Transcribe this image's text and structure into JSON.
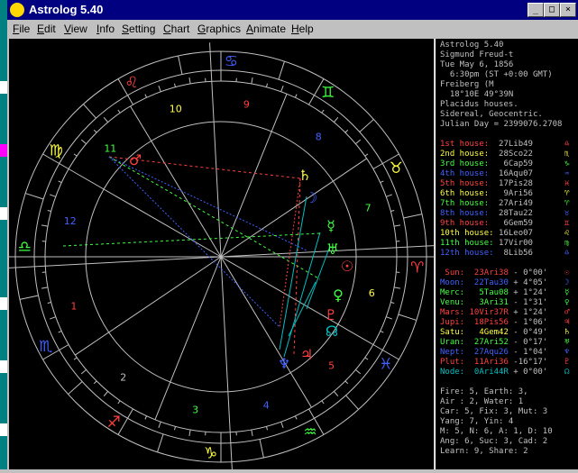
{
  "window": {
    "title": "Astrolog 5.40",
    "buttons": [
      "_",
      "□",
      "×"
    ]
  },
  "menu": [
    {
      "label": "File",
      "accel": "F"
    },
    {
      "label": "Edit",
      "accel": "E"
    },
    {
      "label": "View",
      "accel": "V"
    },
    {
      "label": "Info",
      "accel": "I"
    },
    {
      "label": "Setting",
      "accel": "S"
    },
    {
      "label": "Chart",
      "accel": "C"
    },
    {
      "label": "Graphics",
      "accel": "G"
    },
    {
      "label": "Animate",
      "accel": "A"
    },
    {
      "label": "Help",
      "accel": "H"
    }
  ],
  "header": [
    "Astrolog 5.40",
    "Sigmund Freud-t",
    "Tue May 6, 1856",
    "  6:30pm (ST +0:00 GMT)",
    "Freiberg (M",
    "  18°10E 49°39N",
    "Placidus houses.",
    "Sidereal, Geocentric.",
    "Julian Day = 2399076.2708"
  ],
  "houses": [
    {
      "label": "1st house:",
      "pos": "27Lib49",
      "color": "#ff4040",
      "glyph": "♎"
    },
    {
      "label": "2nd house:",
      "pos": "28Sco22",
      "color": "#ffff40",
      "glyph": "♏"
    },
    {
      "label": "3rd house:",
      "pos": "6Cap59",
      "color": "#40ff40",
      "glyph": "♑"
    },
    {
      "label": "4th house:",
      "pos": "16Aqu07",
      "color": "#4060ff",
      "glyph": "♒"
    },
    {
      "label": "5th house:",
      "pos": "17Pis28",
      "color": "#ff4040",
      "glyph": "♓"
    },
    {
      "label": "6th house:",
      "pos": "9Ari56",
      "color": "#ffff40",
      "glyph": "♈"
    },
    {
      "label": "7th house:",
      "pos": "27Ari49",
      "color": "#40ff40",
      "glyph": "♈"
    },
    {
      "label": "8th house:",
      "pos": "28Tau22",
      "color": "#4060ff",
      "glyph": "♉"
    },
    {
      "label": "9th house:",
      "pos": "6Gem59",
      "color": "#ff4040",
      "glyph": "♊"
    },
    {
      "label": "10th house:",
      "pos": "16Leo07",
      "color": "#ffff40",
      "glyph": "♌"
    },
    {
      "label": "11th house:",
      "pos": "17Vir00",
      "color": "#40ff40",
      "glyph": "♍"
    },
    {
      "label": "12th house:",
      "pos": "8Lib56",
      "color": "#4060ff",
      "glyph": "♎"
    }
  ],
  "planets": [
    {
      "name": "Sun:",
      "pos": "23Ari38",
      "extra": "- 0°00'",
      "color": "#ff4040",
      "glyph": "☉"
    },
    {
      "name": "Moon:",
      "pos": "22Tau30",
      "extra": "+ 4°05'",
      "color": "#4060ff",
      "glyph": "☽"
    },
    {
      "name": "Merc:",
      "pos": "5Tau08",
      "extra": "+ 1°24'",
      "color": "#40ff40",
      "glyph": "☿"
    },
    {
      "name": "Venu:",
      "pos": "3Ari31",
      "extra": "- 1°31'",
      "color": "#40ff40",
      "glyph": "♀"
    },
    {
      "name": "Mars:",
      "pos": "10Vir37R",
      "extra": "+ 1°24'",
      "color": "#ff4040",
      "glyph": "♂"
    },
    {
      "name": "Jupi:",
      "pos": "18Pis56",
      "extra": "- 1°06'",
      "color": "#ff4040",
      "glyph": "♃"
    },
    {
      "name": "Satu:",
      "pos": "4Gem42",
      "extra": "- 0°49'",
      "color": "#ffff40",
      "glyph": "♄"
    },
    {
      "name": "Uran:",
      "pos": "27Ari52",
      "extra": "- 0°17'",
      "color": "#40ff40",
      "glyph": "♅"
    },
    {
      "name": "Nept:",
      "pos": "27Aqu26",
      "extra": "- 1°04'",
      "color": "#4060ff",
      "glyph": "♆"
    },
    {
      "name": "Plut:",
      "pos": "11Ari36",
      "extra": "-16°17'",
      "color": "#ff4040",
      "glyph": "♇"
    },
    {
      "name": "Node:",
      "pos": "0Ari44R",
      "extra": "+ 0°00'",
      "color": "#00c0c0",
      "glyph": "☊"
    }
  ],
  "elements": [
    "Fire: 5, Earth: 3,",
    "Air : 2, Water: 1",
    "Car: 5, Fix: 3, Mut: 3",
    "Yang: 7, Yin: 4",
    "M: 5, N: 6, A: 1, D: 10",
    "Ang: 6, Suc: 3, Cad: 2",
    "Learn: 9, Share: 2"
  ],
  "wheel": {
    "house_numbers": [
      "1",
      "2",
      "3",
      "4",
      "5",
      "6",
      "7",
      "8",
      "9",
      "10",
      "11",
      "12"
    ],
    "signs": [
      {
        "glyph": "♈",
        "name": "aries-sign",
        "color": "#ff4040"
      },
      {
        "glyph": "♉",
        "name": "taurus-sign",
        "color": "#ffff40"
      },
      {
        "glyph": "♊",
        "name": "gemini-sign",
        "color": "#40ff40"
      },
      {
        "glyph": "♋",
        "name": "cancer-sign",
        "color": "#4060ff"
      },
      {
        "glyph": "♌",
        "name": "leo-sign",
        "color": "#ff4040"
      },
      {
        "glyph": "♍",
        "name": "virgo-sign",
        "color": "#ffff40"
      },
      {
        "glyph": "♎",
        "name": "libra-sign",
        "color": "#40ff40"
      },
      {
        "glyph": "♏",
        "name": "scorpio-sign",
        "color": "#4060ff"
      },
      {
        "glyph": "♐",
        "name": "sagittarius-sign",
        "color": "#ff4040"
      },
      {
        "glyph": "♑",
        "name": "capricorn-sign",
        "color": "#ffff40"
      },
      {
        "glyph": "♒",
        "name": "aquarius-sign",
        "color": "#40ff40"
      },
      {
        "glyph": "♓",
        "name": "pisces-sign",
        "color": "#4060ff"
      }
    ]
  }
}
